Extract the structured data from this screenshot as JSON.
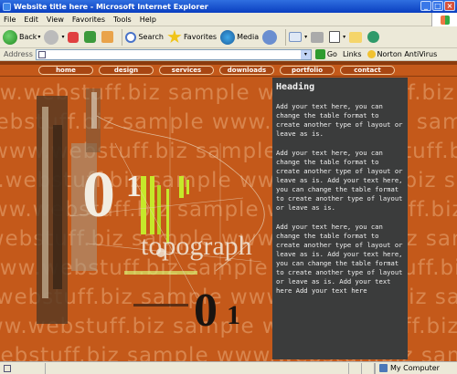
{
  "window": {
    "title": "Website title here - Microsoft Internet Explorer",
    "minimize": "_",
    "maximize": "□",
    "close": "×"
  },
  "menu": [
    "File",
    "Edit",
    "View",
    "Favorites",
    "Tools",
    "Help"
  ],
  "toolbar": {
    "back": "Back",
    "search": "Search",
    "favorites": "Favorites",
    "media": "Media",
    "dropdown": "▾"
  },
  "address": {
    "label": "Address",
    "value": "",
    "go": "Go",
    "links": "Links",
    "extension": "Norton AntiVirus",
    "dropdown": "▾"
  },
  "site": {
    "nav": [
      "home",
      "design",
      "services",
      "downloads",
      "portfolio",
      "contact"
    ],
    "watermark": "www.webstuff.biz  sample  www.webstuff.biz  sample",
    "heading": "Heading",
    "paragraphs": [
      "Add your text here, you can change the table format to create another type of layout or leave as is.",
      "Add your text here, you can change the table format to create another type of layout or leave as is. Add your text here, you can change the table format to create another type of layout or leave as is.",
      "Add your text here, you can change the table format to create another type of layout or leave as is. Add your text here, you can change the table format to create another type of layout or leave as is. Add your text here Add your text here"
    ],
    "artwork_text": {
      "big_digits": "0",
      "digit_one": "1",
      "small_digits": "0",
      "small_one": "1",
      "word": "topograph"
    }
  },
  "status": {
    "zone": "My Computer"
  },
  "colors": {
    "page_background": "#c4591a",
    "content_panel": "#3b3c3c",
    "lime_accent": "#c6e82a"
  }
}
